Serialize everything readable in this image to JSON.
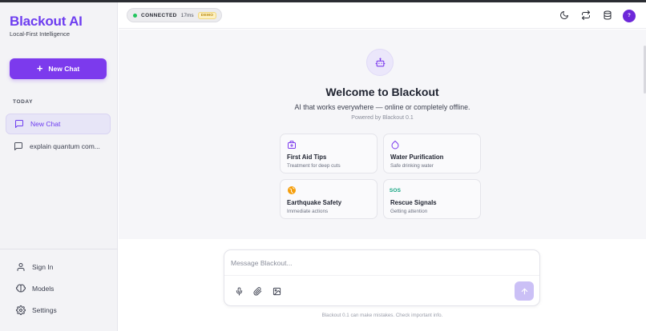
{
  "app": {
    "brand": "Blackout AI",
    "tagline": "Local-First Intelligence",
    "accent_color": "#7c3aed"
  },
  "sidebar": {
    "new_chat_label": "New Chat",
    "section_label": "TODAY",
    "chats": [
      {
        "label": "New Chat",
        "active": true
      },
      {
        "label": "explain quantum com...",
        "active": false
      }
    ],
    "bottom_items": [
      {
        "label": "Sign In",
        "icon": "user-icon"
      },
      {
        "label": "Models",
        "icon": "brain-icon"
      },
      {
        "label": "Settings",
        "icon": "gear-icon"
      }
    ]
  },
  "header": {
    "status": "CONNECTED",
    "latency": "17ms",
    "badge": "DEMO",
    "avatar_initial": "?",
    "icons": [
      "moon-icon",
      "refresh-icon",
      "database-icon"
    ]
  },
  "welcome": {
    "title": "Welcome to Blackout",
    "subtitle": "AI that works everywhere — online or completely offline.",
    "powered_by": "Powered by Blackout 0.1",
    "cards": [
      {
        "title": "First Aid Tips",
        "desc": "Treatment for deep cuts",
        "icon": "first-aid-icon"
      },
      {
        "title": "Water Purification",
        "desc": "Safe drinking water",
        "icon": "water-drop-icon"
      },
      {
        "title": "Earthquake Safety",
        "desc": "Immediate actions",
        "icon": "globe-icon"
      },
      {
        "title": "Rescue Signals",
        "desc": "Getting attention",
        "icon": "sos-icon",
        "icon_text": "SOS"
      }
    ]
  },
  "composer": {
    "placeholder": "Message Blackout...",
    "value": "",
    "disclaimer": "Blackout 0.1 can make mistakes. Check important info."
  }
}
